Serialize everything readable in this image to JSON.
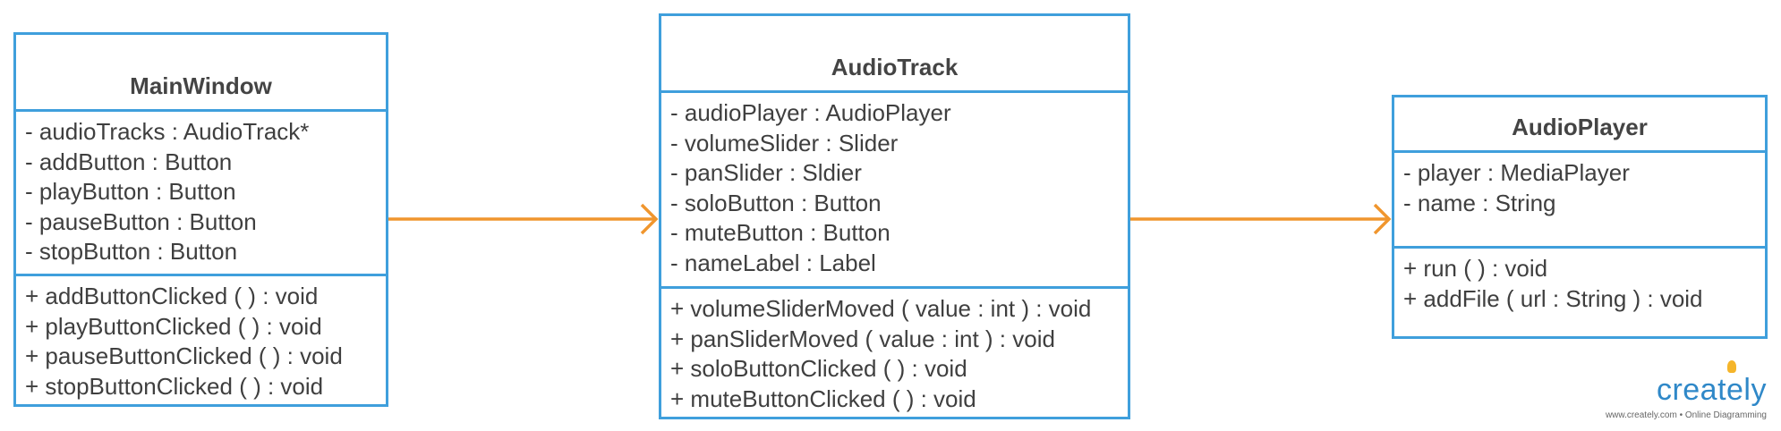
{
  "classes": [
    {
      "name": "MainWindow",
      "attributes": [
        "- audioTracks : AudioTrack*",
        "- addButton : Button",
        "- playButton : Button",
        "- pauseButton : Button",
        "- stopButton : Button"
      ],
      "methods": [
        "+ addButtonClicked ( ) : void",
        "+ playButtonClicked ( ) : void",
        "+ pauseButtonClicked ( ) : void",
        "+ stopButtonClicked ( ) : void"
      ]
    },
    {
      "name": "AudioTrack",
      "attributes": [
        "- audioPlayer : AudioPlayer",
        "- volumeSlider : Slider",
        "- panSlider : Sldier",
        "- soloButton : Button",
        "- muteButton : Button",
        "- nameLabel : Label"
      ],
      "methods": [
        "+ volumeSliderMoved ( value : int ) : void",
        "+ panSliderMoved ( value : int ) : void",
        "+ soloButtonClicked ( ) : void",
        "+ muteButtonClicked ( ) : void"
      ]
    },
    {
      "name": "AudioPlayer",
      "attributes": [
        "- player : MediaPlayer",
        "- name : String"
      ],
      "methods": [
        "+ run ( ) : void",
        "+ addFile ( url : String ) : void"
      ]
    }
  ],
  "relations": [
    {
      "from": "MainWindow",
      "to": "AudioTrack"
    },
    {
      "from": "AudioTrack",
      "to": "AudioPlayer"
    }
  ],
  "colors": {
    "box_border": "#3f9fdc",
    "arrow": "#f0962e",
    "text": "#3f3f3f",
    "brand": "#2f88c8"
  },
  "branding": {
    "logo": "creately",
    "tagline": "www.creately.com • Online Diagramming"
  }
}
